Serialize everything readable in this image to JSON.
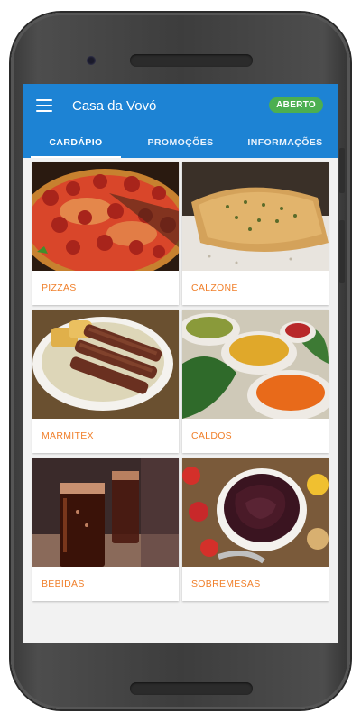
{
  "app": {
    "title": "Casa da Vovó",
    "status": "ABERTO",
    "status_color": "#4caf50",
    "primary_color": "#1d83d4",
    "accent_color": "#f07f2a"
  },
  "tabs": [
    {
      "label": "CARDÁPIO",
      "active": true
    },
    {
      "label": "PROMOÇÕES",
      "active": false
    },
    {
      "label": "INFORMAÇÕES",
      "active": false
    }
  ],
  "categories": [
    {
      "label": "PIZZAS",
      "image": "pizza-photo"
    },
    {
      "label": "CALZONE",
      "image": "calzone-photo"
    },
    {
      "label": "MARMITEX",
      "image": "marmitex-photo"
    },
    {
      "label": "CALDOS",
      "image": "caldos-photo"
    },
    {
      "label": "BEBIDAS",
      "image": "bebidas-photo"
    },
    {
      "label": "SOBREMESAS",
      "image": "sobremesas-photo"
    }
  ]
}
